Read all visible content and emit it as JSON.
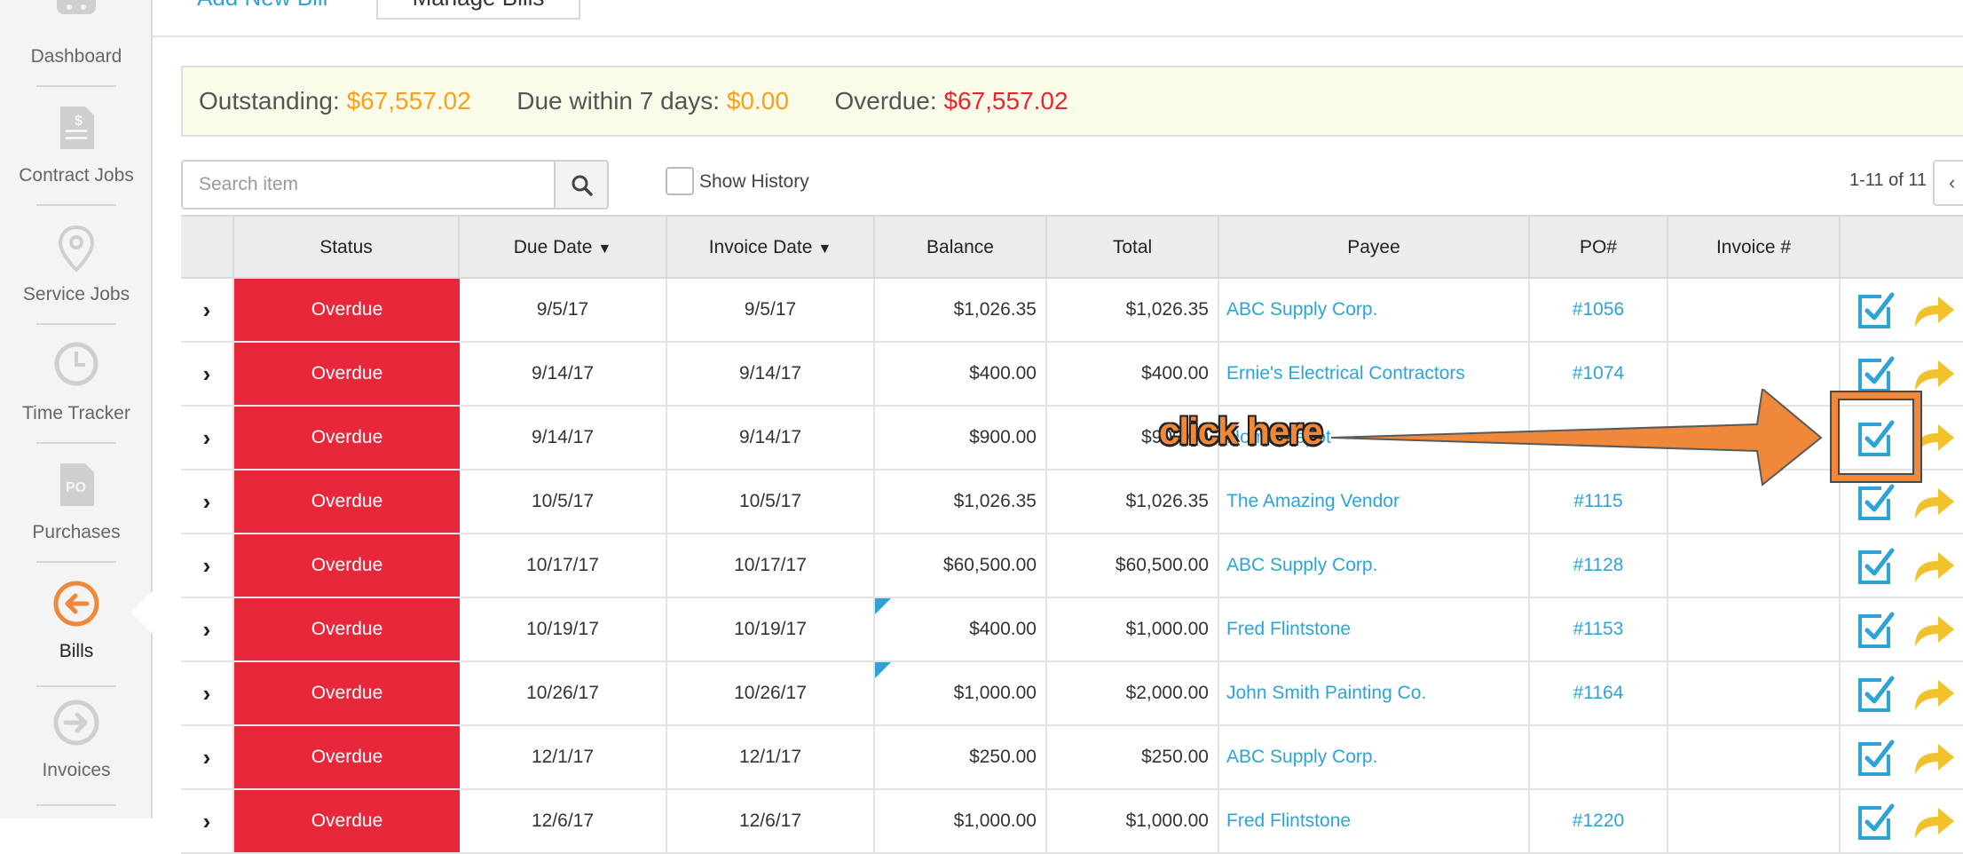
{
  "sidebar": {
    "items": [
      {
        "label": "Dashboard",
        "icon": "speedometer-icon",
        "active": false
      },
      {
        "label": "Contract Jobs",
        "icon": "document-dollar-icon",
        "active": false
      },
      {
        "label": "Service Jobs",
        "icon": "map-pin-icon",
        "active": false
      },
      {
        "label": "Time Tracker",
        "icon": "clock-icon",
        "active": false
      },
      {
        "label": "Purchases",
        "icon": "po-document-icon",
        "active": false
      },
      {
        "label": "Bills",
        "icon": "arrow-left-circle-icon",
        "active": true
      },
      {
        "label": "Invoices",
        "icon": "arrow-right-circle-icon",
        "active": false
      }
    ]
  },
  "tabs": {
    "add": "Add New Bill",
    "manage": "Manage Bills"
  },
  "summary": {
    "outstanding_label": "Outstanding:",
    "outstanding_value": "$67,557.02",
    "due7_label": "Due within 7 days:",
    "due7_value": "$0.00",
    "overdue_label": "Overdue:",
    "overdue_value": "$67,557.02"
  },
  "search": {
    "placeholder": "Search item"
  },
  "history": {
    "label": "Show History",
    "checked": false
  },
  "pager": {
    "text": "1-11 of 11",
    "prev": "‹"
  },
  "table": {
    "headers": {
      "status": "Status",
      "due_date": "Due Date",
      "invoice_date": "Invoice Date",
      "balance": "Balance",
      "total": "Total",
      "payee": "Payee",
      "po": "PO#",
      "invoice_no": "Invoice #"
    },
    "rows": [
      {
        "status": "Overdue",
        "due": "9/5/17",
        "inv": "9/5/17",
        "balance": "$1,026.35",
        "total": "$1,026.35",
        "payee": "ABC Supply Corp.",
        "po": "#1056",
        "invno": "",
        "flag": false
      },
      {
        "status": "Overdue",
        "due": "9/14/17",
        "inv": "9/14/17",
        "balance": "$400.00",
        "total": "$400.00",
        "payee": "Ernie's Electrical Contractors",
        "po": "#1074",
        "invno": "",
        "flag": false
      },
      {
        "status": "Overdue",
        "due": "9/14/17",
        "inv": "9/14/17",
        "balance": "$900.00",
        "total": "$900.00",
        "payee": "Home Depot",
        "po": "",
        "invno": "",
        "flag": false
      },
      {
        "status": "Overdue",
        "due": "10/5/17",
        "inv": "10/5/17",
        "balance": "$1,026.35",
        "total": "$1,026.35",
        "payee": "The Amazing Vendor",
        "po": "#1115",
        "invno": "",
        "flag": false
      },
      {
        "status": "Overdue",
        "due": "10/17/17",
        "inv": "10/17/17",
        "balance": "$60,500.00",
        "total": "$60,500.00",
        "payee": "ABC Supply Corp.",
        "po": "#1128",
        "invno": "",
        "flag": false
      },
      {
        "status": "Overdue",
        "due": "10/19/17",
        "inv": "10/19/17",
        "balance": "$400.00",
        "total": "$1,000.00",
        "payee": "Fred Flintstone",
        "po": "#1153",
        "invno": "",
        "flag": true
      },
      {
        "status": "Overdue",
        "due": "10/26/17",
        "inv": "10/26/17",
        "balance": "$1,000.00",
        "total": "$2,000.00",
        "payee": "John Smith Painting Co.",
        "po": "#1164",
        "invno": "",
        "flag": true
      },
      {
        "status": "Overdue",
        "due": "12/1/17",
        "inv": "12/1/17",
        "balance": "$250.00",
        "total": "$250.00",
        "payee": "ABC Supply Corp.",
        "po": "",
        "invno": "",
        "flag": false
      },
      {
        "status": "Overdue",
        "due": "12/6/17",
        "inv": "12/6/17",
        "balance": "$1,000.00",
        "total": "$1,000.00",
        "payee": "Fred Flintstone",
        "po": "#1220",
        "invno": "",
        "flag": false
      }
    ]
  },
  "annotation": {
    "callout": "click here"
  },
  "colors": {
    "accent_blue": "#2fa3d8",
    "overdue_red": "#e8283a",
    "amount_orange": "#f5a11c",
    "annotation_orange": "#f0883a",
    "forward_yellow": "#f2c12e"
  }
}
